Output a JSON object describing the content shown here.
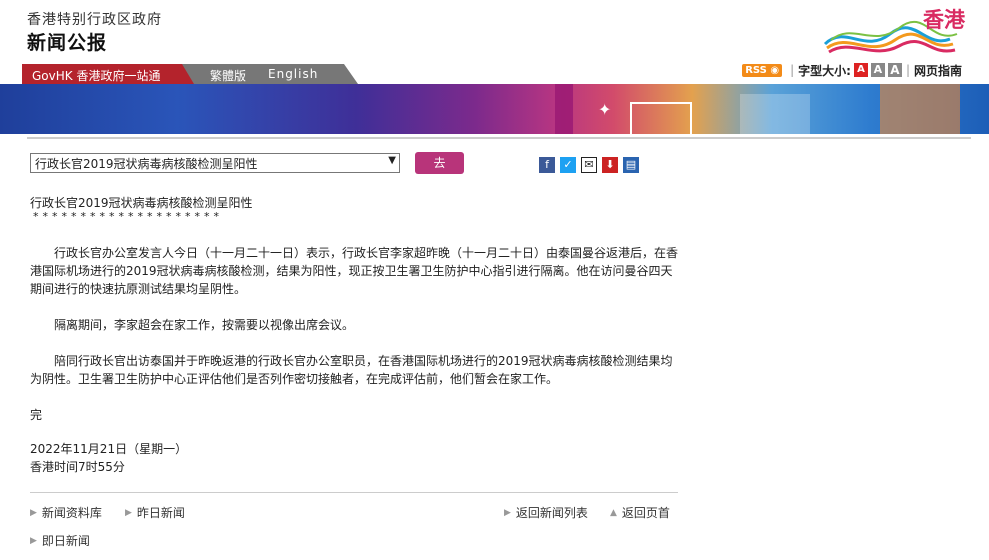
{
  "header": {
    "gov_name": "香港特别行政区政府",
    "title": "新闻公报",
    "logo_text": "香港"
  },
  "nav": {
    "govhk": "GovHK 香港政府一站通",
    "trad": "繁體版",
    "english": "English"
  },
  "toolbar": {
    "rss": "RSS",
    "font_size_label": "字型大小:",
    "font_a": "A",
    "page_guide": "网页指南"
  },
  "selector": {
    "value": "行政长官2019冠状病毒病核酸检测呈阳性",
    "go_label": "去"
  },
  "article": {
    "headline": "行政长官2019冠状病毒病核酸检测呈阳性",
    "stars": "********************",
    "paragraphs": [
      "行政长官办公室发言人今日（十一月二十一日）表示，行政长官李家超昨晚（十一月二十日）由泰国曼谷返港后，在香港国际机场进行的2019冠状病毒病核酸检测，结果为阳性，现正按卫生署卫生防护中心指引进行隔离。他在访问曼谷四天期间进行的快速抗原测试结果均呈阴性。",
      "隔离期间，李家超会在家工作，按需要以视像出席会议。",
      "陪同行政长官出访泰国并于昨晚返港的行政长官办公室职员，在香港国际机场进行的2019冠状病毒病核酸检测结果均为阴性。卫生署卫生防护中心正评估他们是否列作密切接触者，在完成评估前，他们暂会在家工作。"
    ],
    "end": "完",
    "date": "2022年11月21日（星期一）",
    "time": "香港时间7时55分"
  },
  "footer": {
    "news_archive": "新闻资料库",
    "yesterday": "昨日新闻",
    "back_list": "返回新闻列表",
    "back_top": "返回页首",
    "today": "即日新闻"
  }
}
